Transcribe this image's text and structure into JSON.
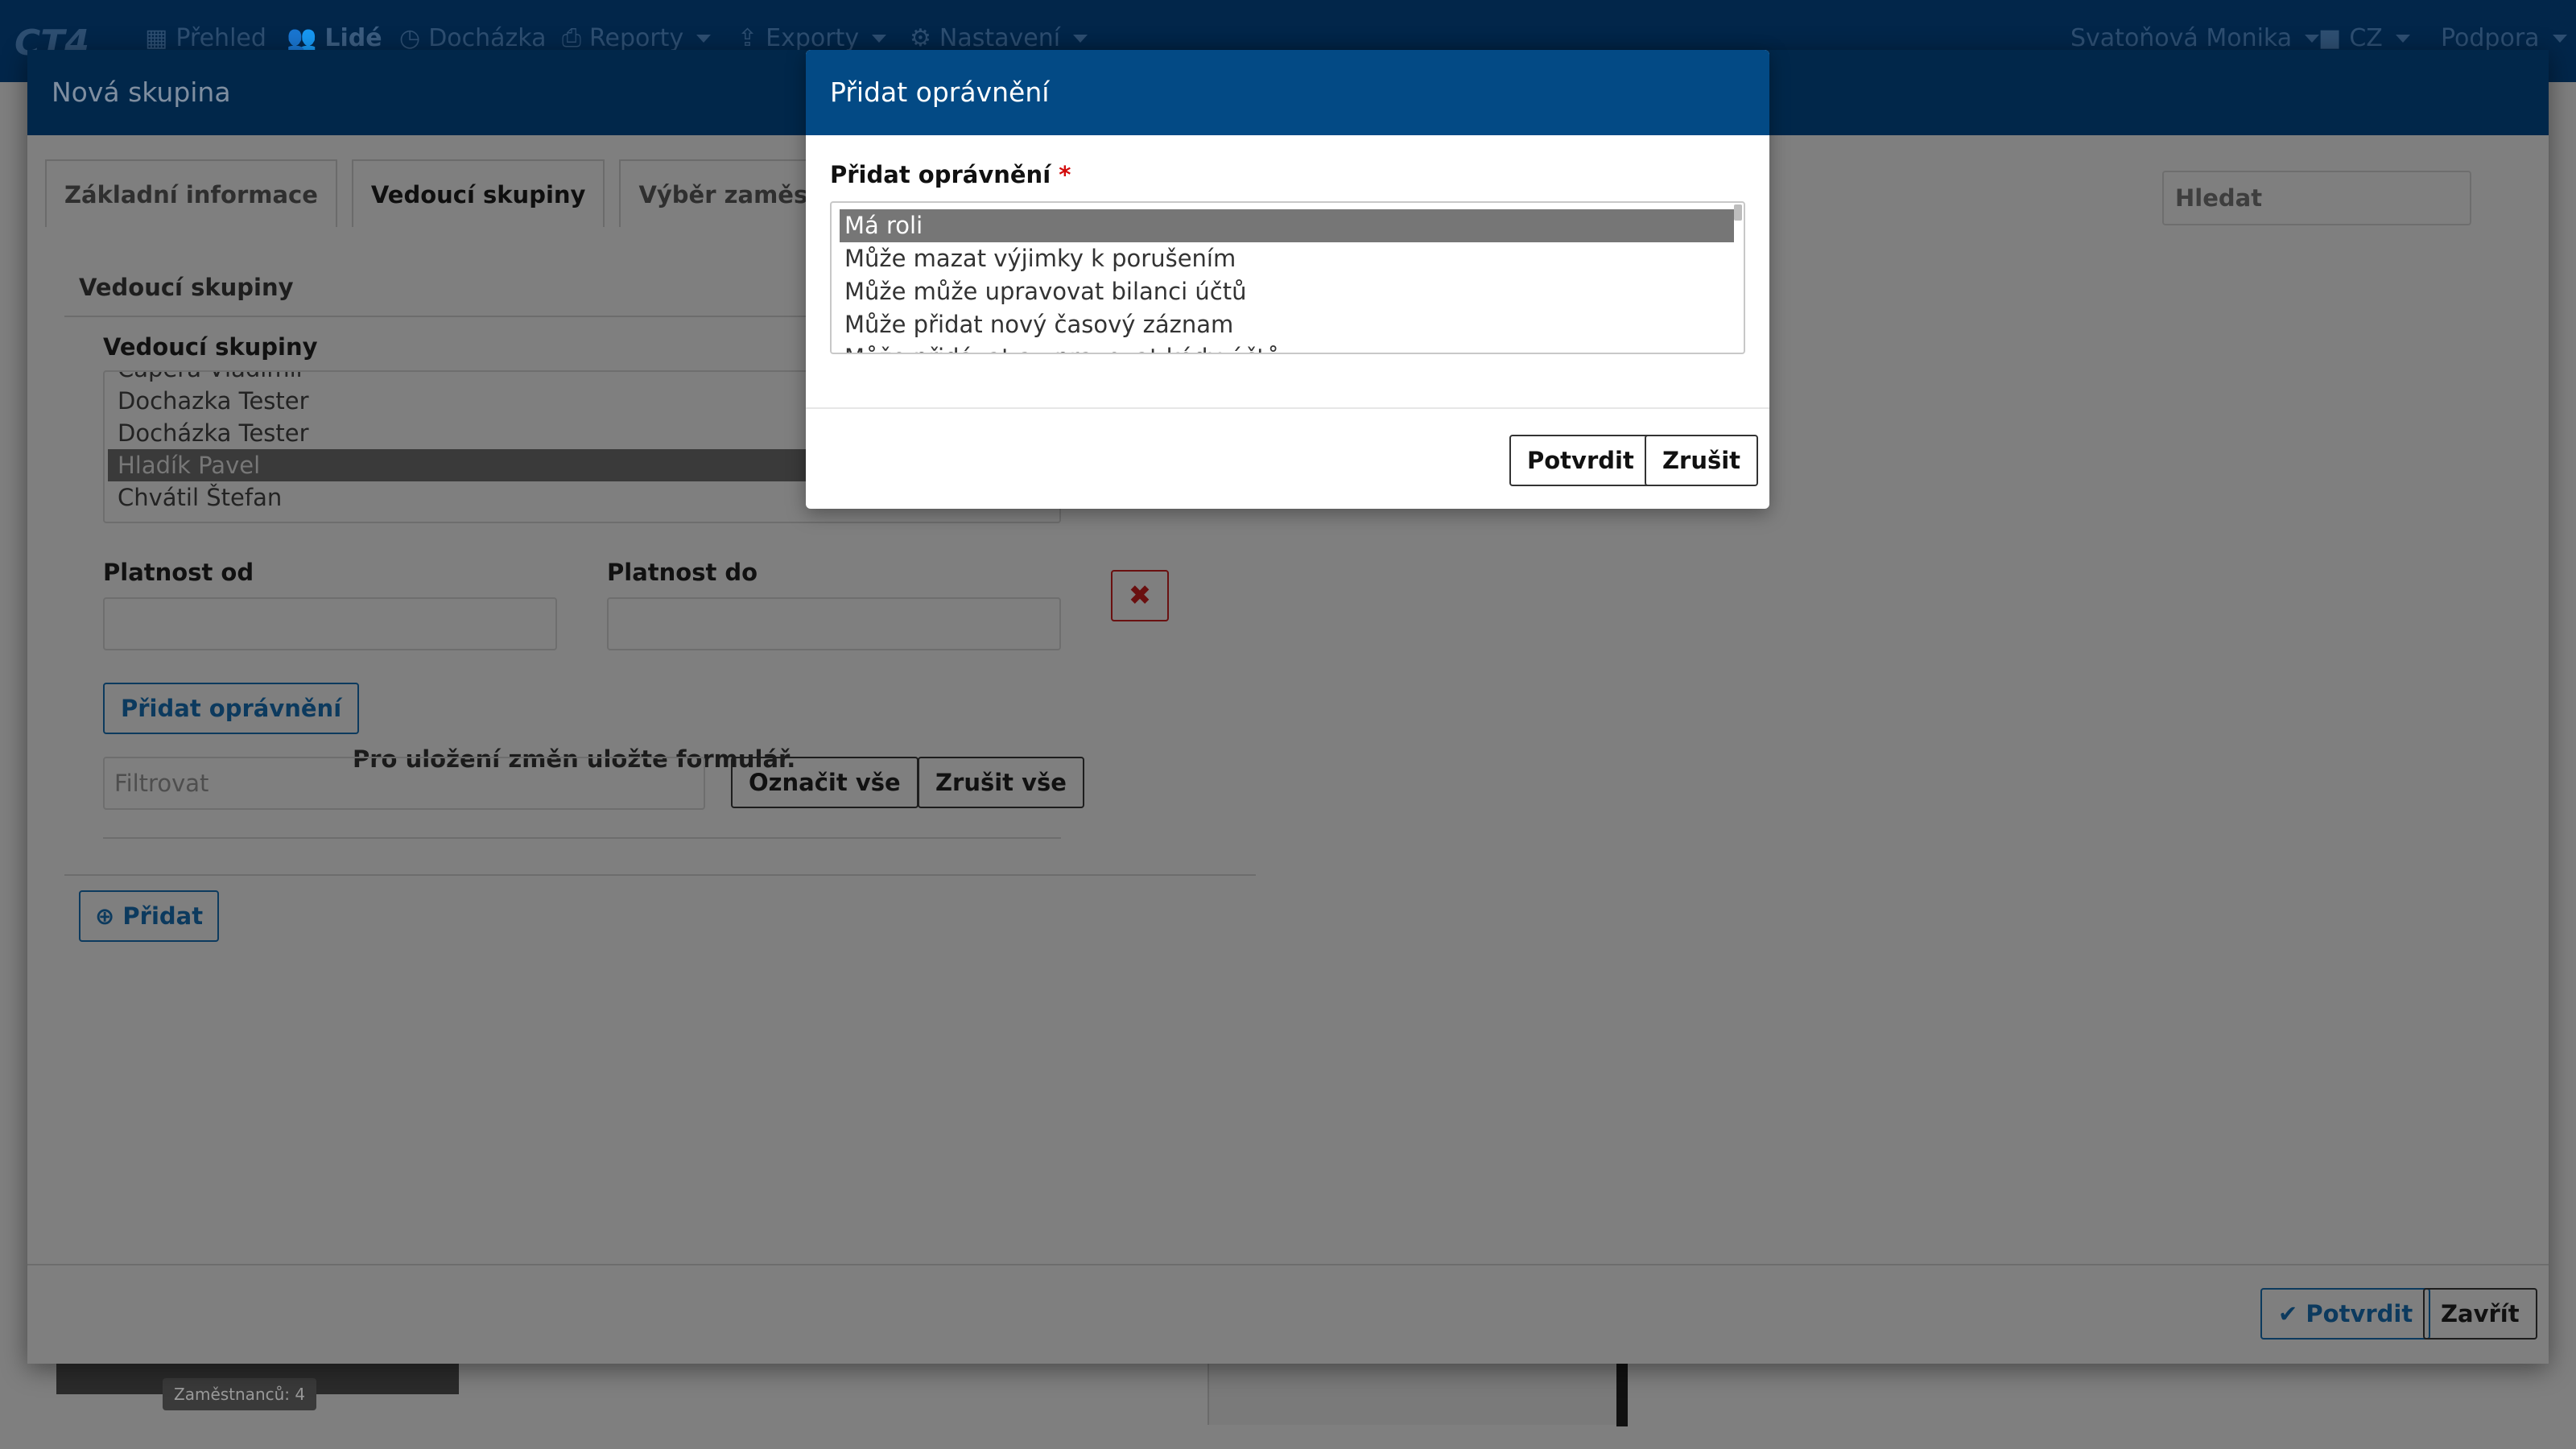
{
  "topnav": {
    "logo": "CT4",
    "items": [
      "Přehled",
      "Lidé",
      "Docházka",
      "Reporty",
      "Exporty",
      "Nastavení"
    ],
    "user": "Svatoňová Monika",
    "lang": "CZ",
    "support": "Podpora"
  },
  "background": {
    "badge": "Zaměstnanců: 4"
  },
  "outer": {
    "title": "Nová skupina",
    "tabs": [
      "Základní informace",
      "Vedoucí skupiny",
      "Výběr zaměstnanců"
    ],
    "search_placeholder": "Hledat",
    "section_title": "Vedoucí skupiny",
    "list_label": "Vedoucí skupiny",
    "list_options": [
      "Čapera Vladimír",
      "Dochazka Tester",
      "Docházka Tester",
      "Hladík Pavel",
      "Chvátil Štefan"
    ],
    "selected_option": "Hladík Pavel",
    "valid_from_label": "Platnost od",
    "valid_to_label": "Platnost do",
    "add_permission_label": "Přidat oprávnění",
    "save_hint": "Pro uložení změn uložte formulář.",
    "filter_placeholder": "Filtrovat",
    "select_all_label": "Označit vše",
    "clear_all_label": "Zrušit vše",
    "add_label": "Přidat",
    "confirm_label": "Potvrdit",
    "close_label": "Zavřít"
  },
  "modal": {
    "title": "Přidat oprávnění",
    "field_label": "Přidat oprávnění",
    "required_mark": "*",
    "options": [
      "Má roli",
      "Může mazat výjimky k porušením",
      "Může může upravovat bilanci účtů",
      "Může přidat nový časový záznam",
      "Může přidávat a upravovat kódy účtů"
    ],
    "selected_option": "Má roli",
    "confirm_label": "Potvrdit",
    "cancel_label": "Zrušit"
  }
}
